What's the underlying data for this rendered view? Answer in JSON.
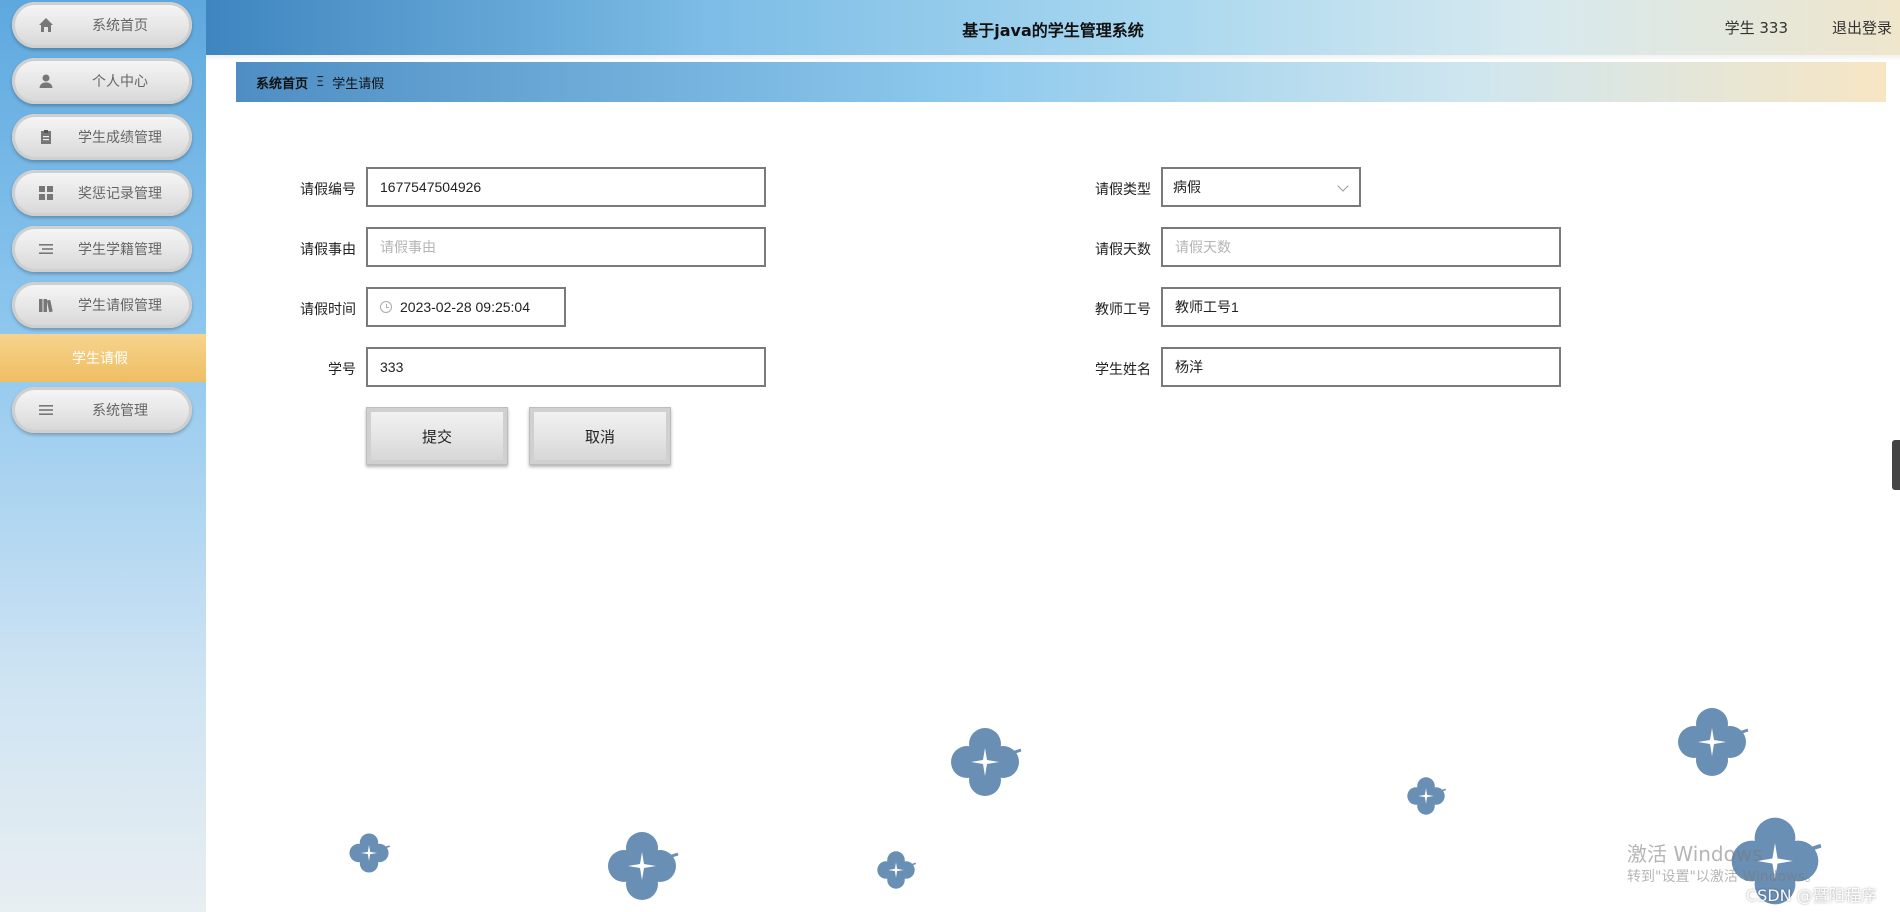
{
  "header": {
    "title": "基于java的学生管理系统",
    "user_label": "学生 333",
    "logout_label": "退出登录"
  },
  "sidebar": {
    "items": [
      {
        "label": "系统首页",
        "icon": "home-icon"
      },
      {
        "label": "个人中心",
        "icon": "user-icon"
      },
      {
        "label": "学生成绩管理",
        "icon": "clipboard-icon"
      },
      {
        "label": "奖惩记录管理",
        "icon": "grid-icon"
      },
      {
        "label": "学生学籍管理",
        "icon": "list-icon"
      },
      {
        "label": "学生请假管理",
        "icon": "books-icon"
      },
      {
        "label": "系统管理",
        "icon": "menu-icon"
      }
    ],
    "active_sub": "学生请假"
  },
  "breadcrumb": {
    "home": "系统首页",
    "separator": "Ξ",
    "current": "学生请假"
  },
  "form": {
    "leave_no": {
      "label": "请假编号",
      "value": "1677547504926"
    },
    "leave_type": {
      "label": "请假类型",
      "value": "病假"
    },
    "leave_reason": {
      "label": "请假事由",
      "value": "",
      "placeholder": "请假事由"
    },
    "leave_days": {
      "label": "请假天数",
      "value": "",
      "placeholder": "请假天数"
    },
    "leave_time": {
      "label": "请假时间",
      "value": "2023-02-28 09:25:04"
    },
    "teacher_no": {
      "label": "教师工号",
      "value": "教师工号1"
    },
    "student_no": {
      "label": "学号",
      "value": "333"
    },
    "student_name": {
      "label": "学生姓名",
      "value": "杨洋"
    },
    "submit_label": "提交",
    "cancel_label": "取消"
  },
  "watermark": {
    "line1": "激活 Windows",
    "line2": "转到\"设置\"以激活 Windows。",
    "line3": "CSDN @暨阳程序"
  },
  "colors": {
    "sidebar_top": "#5ea8de",
    "active_sub": "#eebe62",
    "clover": "#6a8fb5"
  }
}
